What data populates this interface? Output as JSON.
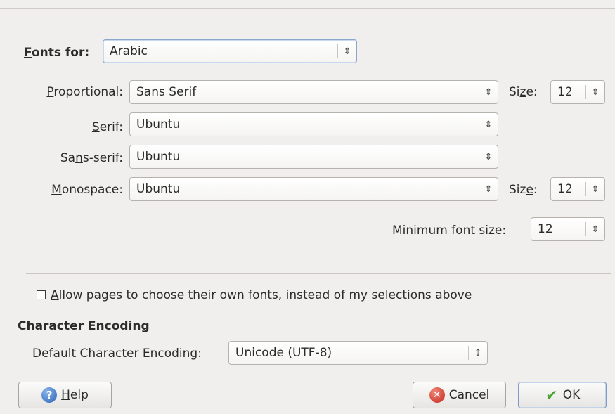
{
  "fonts_for": {
    "label_pre": "",
    "label_u": "F",
    "label_post": "onts for:",
    "value": "Arabic"
  },
  "proportional": {
    "label_u": "P",
    "label_post": "roportional:",
    "value": "Sans Serif",
    "size_label_pre": "Si",
    "size_label_u": "z",
    "size_label_post": "e:",
    "size_value": "12"
  },
  "serif": {
    "label_u": "S",
    "label_post": "erif:",
    "value": "Ubuntu"
  },
  "sans_serif": {
    "label_pre": "Sa",
    "label_u": "n",
    "label_post": "s-serif:",
    "value": "Ubuntu"
  },
  "monospace": {
    "label_u": "M",
    "label_post": "onospace:",
    "value": "Ubuntu",
    "size_label_pre": "Siz",
    "size_label_u": "e",
    "size_label_post": ":",
    "size_value": "12"
  },
  "minimum": {
    "label_pre": "Minimum f",
    "label_u": "o",
    "label_post": "nt size:",
    "value": "12"
  },
  "allow_pages": {
    "checked": false,
    "label_u": "A",
    "label_post": "llow pages to choose their own fonts, instead of my selections above"
  },
  "encoding": {
    "heading": "Character Encoding",
    "label_pre": "Default ",
    "label_u": "C",
    "label_post": "haracter Encoding:",
    "value": "Unicode (UTF-8)"
  },
  "buttons": {
    "help_u": "H",
    "help_post": "elp",
    "cancel": "Cancel",
    "ok": "OK"
  },
  "icons": {
    "combo_arrow": "⇕",
    "help": "?",
    "cancel": "✕",
    "ok": "✔"
  },
  "colors": {
    "background": "#f0efee",
    "focus_border": "#8aa6c9",
    "cancel_red": "#c4271b",
    "ok_green": "#4aa12f",
    "help_blue": "#2c62b8"
  }
}
